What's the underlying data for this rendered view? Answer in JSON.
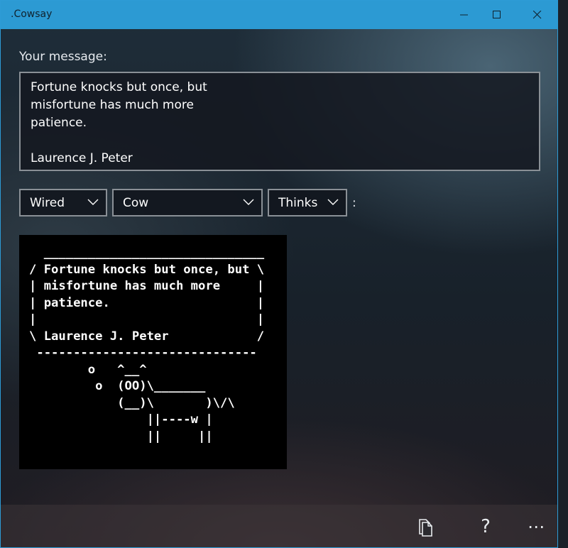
{
  "window": {
    "title": ".Cowsay"
  },
  "form": {
    "message_label": "Your message:",
    "message_value": "Fortune knocks but once, but\nmisfortune has much more\npatience.\n\nLaurence J. Peter",
    "style_select": "Wired",
    "animal_select": "Cow",
    "mode_select": "Thinks",
    "colon": ":"
  },
  "output": {
    "ascii": "  ______________________________\n/ Fortune knocks but once, but \\\n| misfortune has much more     |\n| patience.                    |\n|                              |\n\\ Laurence J. Peter            /\n ------------------------------\n        o   ^__^\n         o  (OO)\\_______\n            (__)\\       )\\/\\\n                ||----w |\n                ||     ||"
  },
  "appbar": {
    "icons": [
      "copy-icon",
      "help-icon",
      "more-icon"
    ],
    "help_glyph": "?",
    "more_glyph": "⋯"
  },
  "colors": {
    "titlebar": "#2c9ad3",
    "border": "#8a9096",
    "cow_bg": "#000000"
  }
}
